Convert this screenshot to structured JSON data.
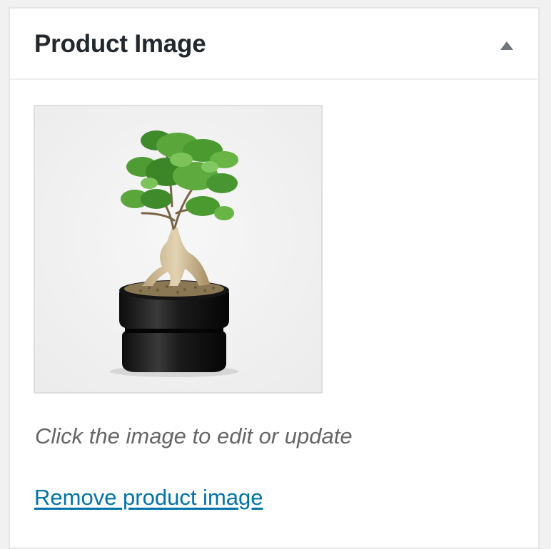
{
  "panel": {
    "title": "Product Image",
    "toggle_icon": "triangle-up-icon"
  },
  "product_image": {
    "depicts": "bonsai-tree-photo",
    "hint": "Click the image to edit or update"
  },
  "actions": {
    "remove_label": "Remove product image"
  },
  "colors": {
    "panel_bg": "#ffffff",
    "page_bg": "#f1f1f1",
    "title_text": "#23282d",
    "hint_text": "#666666",
    "link": "#0073aa",
    "border": "#e5e5e5"
  }
}
